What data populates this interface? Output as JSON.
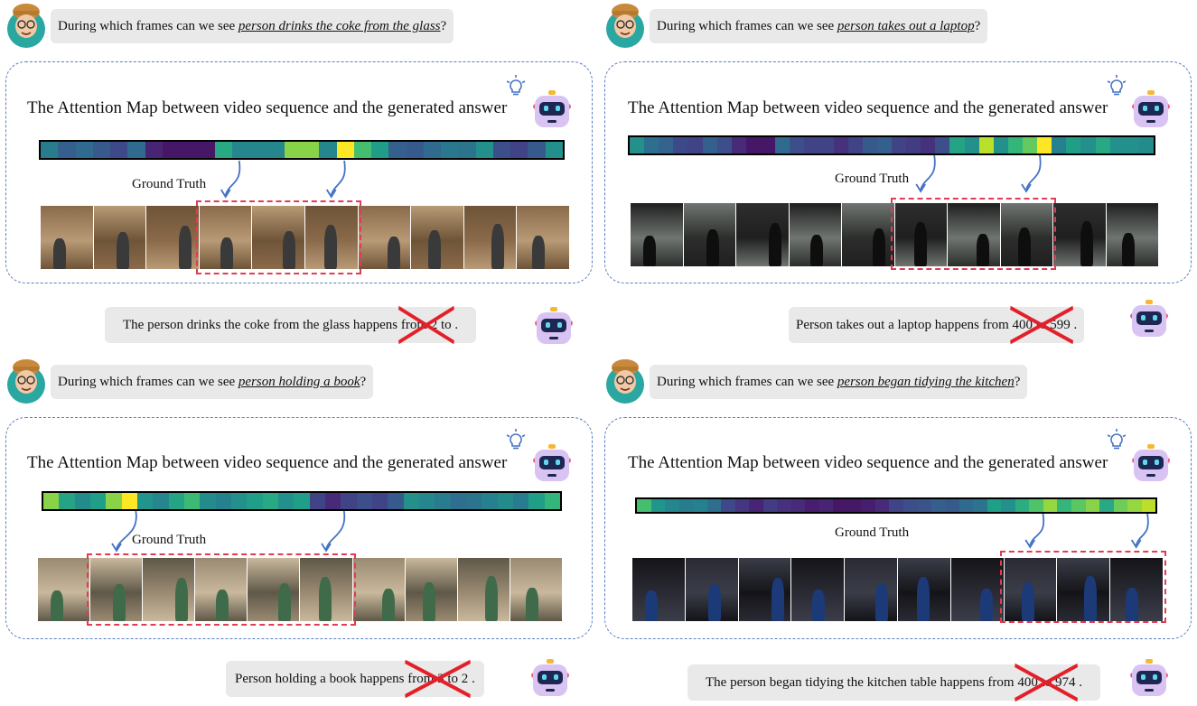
{
  "colors": {
    "question_bg": "#e9e9e9",
    "dashed_border": "#5a7fbf",
    "ground_truth_border": "#e23b52",
    "arrow": "#4472c4",
    "cross": "#e3202a"
  },
  "icons": {
    "user": "user-avatar-icon",
    "robot": "robot-icon",
    "idea": "lightbulb-icon"
  },
  "panels": [
    {
      "question_prefix": "During which frames can we see ",
      "question_query": "person drinks the coke from the glass",
      "question_suffix": "?",
      "attention_title": "The Attention Map between video sequence and the generated answer",
      "ground_truth_label": "Ground Truth",
      "heatmap": [
        0.42,
        0.3,
        0.34,
        0.28,
        0.22,
        0.34,
        0.1,
        0.06,
        0.06,
        0.06,
        0.6,
        0.46,
        0.46,
        0.46,
        0.82,
        0.82,
        0.46,
        1.0,
        0.7,
        0.55,
        0.3,
        0.28,
        0.34,
        0.4,
        0.38,
        0.5,
        0.24,
        0.2,
        0.28,
        0.5
      ],
      "frame_count": 10,
      "frame_style": "indoor-bright",
      "ground_truth_frames": [
        3,
        5
      ],
      "arrow_targets": [
        3,
        5
      ],
      "answer_prefix": "The person drinks the coke from the glass happens ",
      "answer_wrong": "from 2 to",
      "answer_suffix": " ."
    },
    {
      "question_prefix": "During which frames can we see ",
      "question_query": "person takes out a laptop",
      "question_suffix": "?",
      "attention_title": "The Attention Map between video sequence and the generated answer",
      "ground_truth_label": "Ground Truth",
      "heatmap": [
        0.5,
        0.36,
        0.32,
        0.22,
        0.2,
        0.3,
        0.24,
        0.12,
        0.06,
        0.06,
        0.34,
        0.24,
        0.2,
        0.2,
        0.14,
        0.2,
        0.28,
        0.3,
        0.2,
        0.18,
        0.14,
        0.24,
        0.58,
        0.5,
        0.9,
        0.5,
        0.66,
        0.76,
        1.0,
        0.44,
        0.56,
        0.5,
        0.6,
        0.5,
        0.5,
        0.48
      ],
      "frame_count": 10,
      "frame_style": "doorway-dark",
      "ground_truth_frames": [
        5,
        7
      ],
      "arrow_targets": [
        5,
        7
      ],
      "answer_prefix": "Person takes out a laptop happens from ",
      "answer_wrong": "400 to 599",
      "answer_suffix": " ."
    },
    {
      "question_prefix": "During which frames can we see ",
      "question_query": "person holding a book",
      "question_suffix": "?",
      "attention_title": "The Attention Map between video sequence and the generated answer",
      "ground_truth_label": "Ground Truth",
      "heatmap": [
        0.82,
        0.58,
        0.48,
        0.56,
        0.82,
        1.0,
        0.52,
        0.46,
        0.58,
        0.68,
        0.48,
        0.44,
        0.5,
        0.56,
        0.6,
        0.5,
        0.56,
        0.2,
        0.12,
        0.2,
        0.24,
        0.2,
        0.28,
        0.5,
        0.46,
        0.42,
        0.36,
        0.38,
        0.44,
        0.48,
        0.42,
        0.56,
        0.66
      ],
      "frame_count": 10,
      "frame_style": "room-green",
      "ground_truth_frames": [
        1,
        5
      ],
      "arrow_targets": [
        1,
        5
      ],
      "answer_prefix": "Person holding a book happens ",
      "answer_wrong": "from 3 to 2",
      "answer_suffix": " ."
    },
    {
      "question_prefix": "During which frames can we see ",
      "question_query": "person began tidying the kitchen",
      "question_suffix": "?",
      "attention_title": "The Attention Map between video sequence and the generated answer",
      "ground_truth_label": "Ground Truth",
      "heatmap": [
        0.7,
        0.52,
        0.46,
        0.42,
        0.44,
        0.36,
        0.22,
        0.16,
        0.1,
        0.18,
        0.14,
        0.12,
        0.08,
        0.1,
        0.06,
        0.06,
        0.08,
        0.12,
        0.2,
        0.24,
        0.26,
        0.3,
        0.28,
        0.34,
        0.38,
        0.56,
        0.5,
        0.62,
        0.72,
        0.84,
        0.66,
        0.74,
        0.82,
        0.6,
        0.78,
        0.84,
        0.9
      ],
      "frame_count": 10,
      "frame_style": "kitchen-dark",
      "ground_truth_frames": [
        7,
        9
      ],
      "arrow_targets": [
        7,
        9
      ],
      "answer_prefix": "The person began tidying the kitchen table happens from ",
      "answer_wrong": "400 to 974",
      "answer_suffix": " ."
    }
  ]
}
